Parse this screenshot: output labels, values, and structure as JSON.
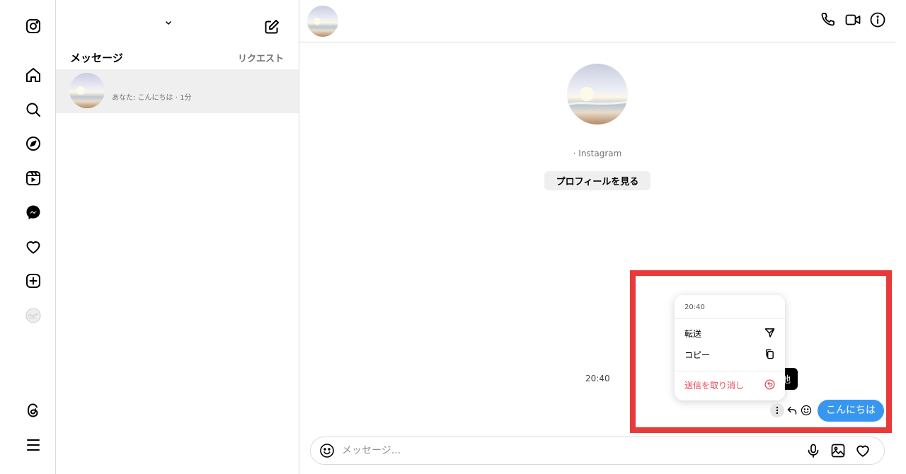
{
  "inbox": {
    "account_name": "",
    "tab_messages": "メッセージ",
    "tab_requests": "リクエスト",
    "threads": [
      {
        "name": "",
        "preview": "あなた: こんにちは · 1分"
      }
    ]
  },
  "chat": {
    "contact_subline": "· Instagram",
    "view_profile_label": "プロフィールを見る",
    "timestamp": "20:40",
    "message_text": "こんにちは",
    "chip_text": "他",
    "menu": {
      "time": "20:40",
      "items": [
        {
          "label": "転送",
          "icon": "send-icon"
        },
        {
          "label": "コピー",
          "icon": "copy-icon"
        },
        {
          "label": "送信を取り消し",
          "icon": "unsend-icon"
        }
      ]
    },
    "composer_placeholder": "メッセージ..."
  },
  "icons": {
    "rail": [
      "instagram-logo-icon",
      "home-icon",
      "search-icon",
      "explore-icon",
      "reels-icon",
      "messenger-icon",
      "heart-icon",
      "create-icon",
      "profile-avatar-icon",
      "threads-icon",
      "menu-icon"
    ],
    "header": [
      "phone-icon",
      "video-icon",
      "info-icon"
    ],
    "composer": [
      "emoji-icon",
      "microphone-icon",
      "image-icon",
      "heart-icon"
    ]
  },
  "colors": {
    "accent_blue": "#3797f0",
    "highlight_red": "#e93a3a",
    "danger_red": "#e8485a",
    "selected_bg": "#efefef"
  }
}
